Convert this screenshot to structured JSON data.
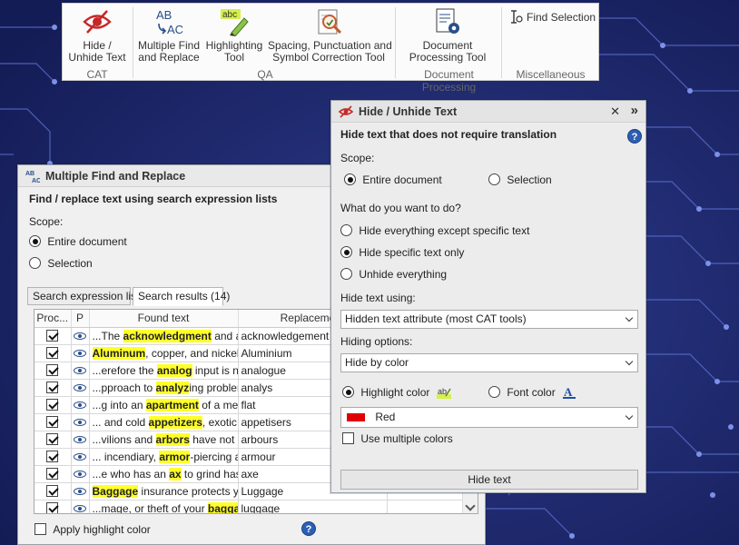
{
  "ribbon": {
    "buttons": [
      {
        "id": "hide",
        "line1": "Hide /",
        "line2": "Unhide Text",
        "icon": "hide-text-icon"
      },
      {
        "id": "mfr",
        "line1": "Multiple Find",
        "line2": "and Replace",
        "icon": "find-replace-icon"
      },
      {
        "id": "highlight",
        "line1": "Highlighting",
        "line2": "Tool",
        "icon": "highlighter-icon"
      },
      {
        "id": "spacing",
        "line1": "Spacing, Punctuation and",
        "line2": "Symbol Correction Tool",
        "icon": "correction-icon"
      },
      {
        "id": "docproc",
        "line1": "Document",
        "line2": "Processing Tool",
        "icon": "document-gear-icon"
      }
    ],
    "find_selection": "Find Selection",
    "groups": {
      "cat": "CAT",
      "qa": "QA",
      "docproc": "Document Processing",
      "misc": "Miscellaneous"
    },
    "ab_text": "AB",
    "ac_text": "AC",
    "abc_text": "abc"
  },
  "mfr": {
    "title": "Multiple Find and Replace",
    "heading": "Find / replace text using search expression lists",
    "scope_label": "Scope:",
    "scope_options": [
      "Entire document",
      "Selection"
    ],
    "scope_selected": 0,
    "tabs": [
      "Search expression list",
      "Search results (14)"
    ],
    "active_tab": 1,
    "columns": [
      "Proc...",
      "P",
      "Found text",
      "Replacement"
    ],
    "rows": [
      {
        "pre": "...The ",
        "hl": "acknowledgment",
        "post": " and ac...",
        "rep": "acknowledgement"
      },
      {
        "pre": "",
        "hl": "Aluminum",
        "post": ", copper, and nickel it...",
        "rep": "Aluminium"
      },
      {
        "pre": "...erefore the ",
        "hl": "analog",
        "post": " input is not ...",
        "rep": "analogue"
      },
      {
        "pre": "...pproach to ",
        "hl": "analyz",
        "post": "ing problem...",
        "rep": "analys"
      },
      {
        "pre": "...g into an ",
        "hl": "apartment",
        "post": " of a mem...",
        "rep": "flat"
      },
      {
        "pre": "... and cold ",
        "hl": "appetizers",
        "post": ", exotic s...",
        "rep": "appetisers"
      },
      {
        "pre": "...vilions and ",
        "hl": "arbors",
        "post": " have not s...",
        "rep": "arbours"
      },
      {
        "pre": "... incendiary, ",
        "hl": "armor",
        "post": "-piercing a...",
        "rep": "armour"
      },
      {
        "pre": "...e who has an ",
        "hl": "ax",
        "post": " to grind has ...",
        "rep": "axe"
      },
      {
        "pre": "",
        "hl": "Baggage",
        "post": " insurance protects yo...",
        "rep": "Luggage"
      },
      {
        "pre": "...mage, or theft of your ",
        "hl": "baggage",
        "post": ".",
        "rep": "luggage"
      }
    ],
    "apply_highlight": "Apply highlight color",
    "help": "?"
  },
  "hide": {
    "title": "Hide / Unhide Text",
    "close": "✕",
    "expand": "»",
    "heading": "Hide text that does not require translation",
    "help": "?",
    "scope_label": "Scope:",
    "scope_options": [
      "Entire document",
      "Selection"
    ],
    "what_label": "What do you want to do?",
    "actions": [
      "Hide everything except specific text",
      "Hide specific text only",
      "Unhide everything"
    ],
    "hide_using_label": "Hide text using:",
    "hide_using_value": "Hidden text attribute (most CAT tools)",
    "hiding_options_label": "Hiding options:",
    "hiding_options_value": "Hide by color",
    "color_modes": [
      "Highlight color",
      "Font color"
    ],
    "color_value": "Red",
    "color_hex": "#e00000",
    "multiple_colors": "Use multiple colors",
    "hide_button": "Hide text",
    "ab_text": "ab",
    "a_text": "A"
  }
}
